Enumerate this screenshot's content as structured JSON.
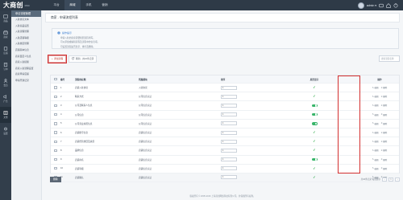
{
  "brand": {
    "name": "大商创",
    "sub": "DSC"
  },
  "topnav": [
    "平台",
    "商城",
    "手机",
    "营销"
  ],
  "topnav_active": 1,
  "user": {
    "name": "admin ▾"
  },
  "rail": [
    {
      "label": "商品",
      "icon": "box-icon"
    },
    {
      "label": "商家",
      "icon": "store-icon"
    },
    {
      "label": "店铺",
      "icon": "shop-icon"
    },
    {
      "label": "订单",
      "icon": "order-icon"
    },
    {
      "label": "会员",
      "icon": "user-icon"
    },
    {
      "label": "广告",
      "icon": "ad-icon"
    },
    {
      "label": "文章",
      "icon": "article-icon"
    },
    {
      "label": "设置",
      "icon": "settings-icon"
    }
  ],
  "rail_active": 6,
  "subnav": {
    "head": "申请流程管理",
    "items": [
      "入驻协议文本",
      "入驻商品设置",
      "入驻流程管理",
      "入驻店铺等级",
      "入驻类目管理",
      "店铺基本信息",
      "商家自定义信息",
      "商家入驻提醒",
      "商家入驻流程设置",
      "商家申请店铺",
      "申请开通记录"
    ]
  },
  "page": {
    "title": "商家 - 申请流程列表"
  },
  "tip": {
    "title": "操作提示",
    "lines": [
      "申请入驻的商家需要按照流程填写。",
      "可以添加或编辑流程及流程中的信息项。",
      "可设置流程是否显示、排序及删除。"
    ]
  },
  "toolbar": {
    "add_label": "添加流程",
    "refresh_label": "刷新 - 共10条记录",
    "search_placeholder": "搜索流程名称"
  },
  "table": {
    "headers": [
      "",
      "编号",
      "流程的标题",
      "所属模块",
      "排序",
      "是否显示",
      "操作"
    ],
    "rows": [
      {
        "id": "1",
        "name": "店铺入驻协议",
        "module": "入驻协议",
        "sort": "1",
        "status": "check"
      },
      {
        "id": "2",
        "name": "联系方式",
        "module": "公司信息认证",
        "sort": "1",
        "status": "check"
      },
      {
        "id": "3",
        "name": "公司及联系人信息",
        "module": "公司信息认证",
        "sort": "1",
        "status": "toggle"
      },
      {
        "id": "4",
        "name": "公司信息",
        "module": "公司信息认证",
        "sort": "1",
        "status": "toggle"
      },
      {
        "id": "5",
        "name": "公司营业执照信息",
        "module": "公司信息认证",
        "sort": "1",
        "status": "toggle"
      },
      {
        "id": "6",
        "name": "店铺账号信息",
        "module": "店铺信息认证",
        "sort": "1",
        "status": "check"
      },
      {
        "id": "7",
        "name": "店铺经营类目及资质",
        "module": "店铺信息认证",
        "sort": "1",
        "status": "check"
      },
      {
        "id": "8",
        "name": "品牌信息",
        "module": "店铺信息认证",
        "sort": "1",
        "status": "check"
      },
      {
        "id": "9",
        "name": "店铺命名",
        "module": "店铺信息认证",
        "sort": "1",
        "status": "toggle"
      },
      {
        "id": "10",
        "name": "店铺等级",
        "module": "店铺信息认证",
        "sort": "1",
        "status": "check"
      },
      {
        "id": "11",
        "name": "店铺确认",
        "module": "店铺信息认证",
        "sort": "1",
        "status": "check"
      }
    ],
    "op_edit": "编辑",
    "op_delete": "删除"
  },
  "footer": {
    "delete_label": "删除",
    "pager_text": "共10条记录 每页显示",
    "page_current": "1"
  },
  "copyright": "版权所有 © 2005-2016 上海商创网络科技有限公司，并保留所有权利。",
  "colors": {
    "accent": "#d32f2f",
    "topbar": "#2e3a47",
    "rail": "#323e4b",
    "ok": "#28a745"
  }
}
